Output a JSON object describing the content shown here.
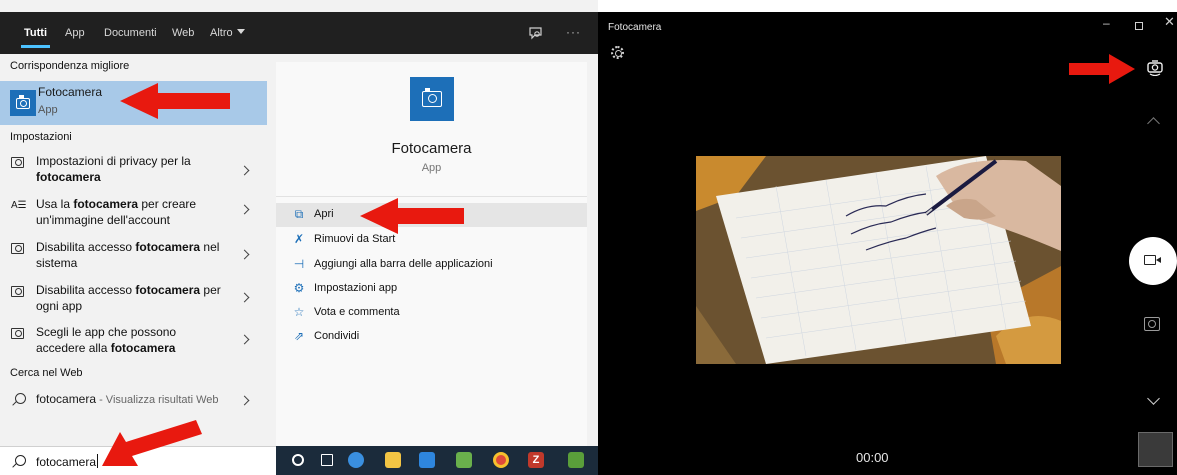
{
  "search_tabs": {
    "all": "Tutti",
    "apps": "App",
    "documents": "Documenti",
    "web": "Web",
    "more": "Altro",
    "more_dots": "···"
  },
  "results": {
    "best_match_header": "Corrispondenza migliore",
    "best_match": {
      "title": "Fotocamera",
      "subtitle": "App"
    },
    "settings_header": "Impostazioni",
    "settings_items": [
      {
        "before": "Impostazioni di privacy per la ",
        "bold": "",
        "after": "fotocamera",
        "icon": "camera-icon"
      },
      {
        "before": "Usa la ",
        "bold": "fotocamera",
        "after": " per creare un'immagine dell'account",
        "icon": "account-picture-icon"
      },
      {
        "before": "Disabilita accesso ",
        "bold": "fotocamera",
        "after": " nel sistema",
        "icon": "camera-icon"
      },
      {
        "before": "Disabilita accesso ",
        "bold": "fotocamera",
        "after": " per ogni app",
        "icon": "camera-icon"
      },
      {
        "before": "Scegli le app che possono accedere alla ",
        "bold": "fotocamera",
        "after": "",
        "icon": "camera-icon"
      }
    ],
    "web_header": "Cerca nel Web",
    "web_item": {
      "query": "fotocamera",
      "hint": " - Visualizza risultati Web"
    }
  },
  "preview": {
    "title": "Fotocamera",
    "subtitle": "App",
    "actions": [
      {
        "label": "Apri",
        "icon": "open-icon",
        "glyph": "⧉"
      },
      {
        "label": "Rimuovi da Start",
        "icon": "unpin-icon",
        "glyph": "✗"
      },
      {
        "label": "Aggiungi alla barra delle applicazioni",
        "icon": "pin-taskbar-icon",
        "glyph": "⊣"
      },
      {
        "label": "Impostazioni app",
        "icon": "gear-icon",
        "glyph": "⚙"
      },
      {
        "label": "Vota e commenta",
        "icon": "rate-icon",
        "glyph": "☆"
      },
      {
        "label": "Condividi",
        "icon": "share-icon",
        "glyph": "⇗"
      }
    ]
  },
  "search_box": {
    "value": "fotocamera"
  },
  "taskbar": {
    "filezilla_glyph": "Z"
  },
  "camera_window": {
    "title": "Fotocamera",
    "min_glyph": "–",
    "close_glyph": "✕",
    "timer": "00:00"
  },
  "colors": {
    "accent": "#1d6fb8",
    "selection": "#a8c9e8",
    "arrow": "#e8190f",
    "dark_header": "#202020"
  }
}
